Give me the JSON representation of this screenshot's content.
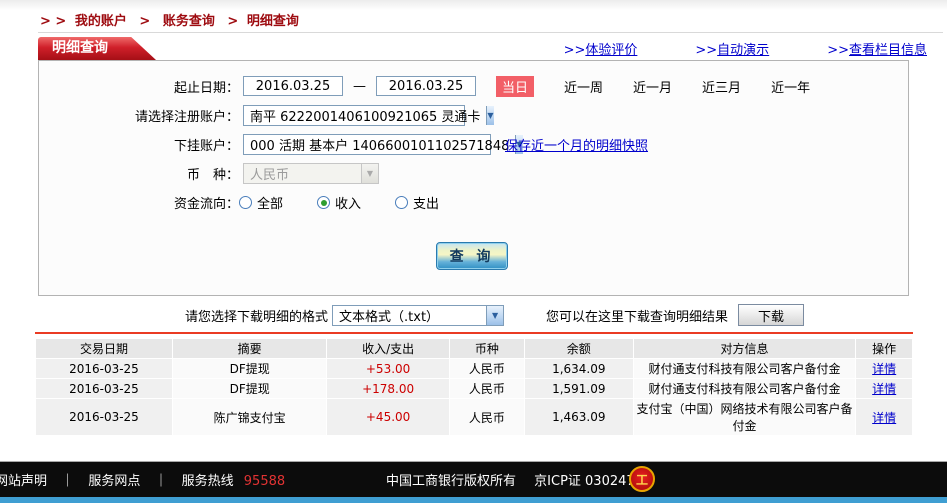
{
  "breadcrumb": {
    "prefix": "> >",
    "sep": ">",
    "items": [
      "我的账户",
      "账务查询",
      "明细查询"
    ]
  },
  "tab": {
    "title": "明细查询"
  },
  "links_prefix": ">>",
  "links": [
    "体验评价",
    "自动演示",
    "查看栏目信息"
  ],
  "form": {
    "date_label": "起止日期：",
    "date_from": "2016.03.25",
    "date_sep": "—",
    "date_to": "2016.03.25",
    "quick": {
      "active": "当日",
      "options": [
        "近一周",
        "近一月",
        "近三月",
        "近一年"
      ]
    },
    "account_label": "请选择注册账户：",
    "account_value": "南平 6222001406100921065 灵通卡",
    "sub_account_label": "下挂账户：",
    "sub_account_value": "000 活期 基本户 1406600101102571848",
    "snapshot_link": "保存近一个月的明细快照",
    "currency_label": "币　种：",
    "currency_value": "人民币",
    "flow_label": "资金流向：",
    "flow": {
      "options": [
        "全部",
        "收入",
        "支出"
      ],
      "selected": "收入"
    },
    "query_button": "查 询"
  },
  "download": {
    "format_label": "请您选择下载明细的格式",
    "format_value": "文本格式（.txt）",
    "hint": "您可以在这里下载查询明细结果",
    "button": "下载"
  },
  "table": {
    "headers": [
      "交易日期",
      "摘要",
      "收入/支出",
      "币种",
      "余额",
      "对方信息",
      "操作"
    ],
    "rows": [
      {
        "date": "2016-03-25",
        "summary": "DF提现",
        "amount": "+53.00",
        "currency": "人民币",
        "balance": "1,634.09",
        "counterparty": "财付通支付科技有限公司客户备付金",
        "action": "详情"
      },
      {
        "date": "2016-03-25",
        "summary": "DF提现",
        "amount": "+178.00",
        "currency": "人民币",
        "balance": "1,591.09",
        "counterparty": "财付通支付科技有限公司客户备付金",
        "action": "详情"
      },
      {
        "date": "2016-03-25",
        "summary": "陈广锦支付宝",
        "amount": "+45.00",
        "currency": "人民币",
        "balance": "1,463.09",
        "counterparty": "支付宝（中国）网络技术有限公司客户备付金",
        "action": "详情"
      }
    ]
  },
  "footer": {
    "link_statement": "网站声明",
    "link_branches": "服务网点",
    "sep": "｜",
    "hotline_label": "服务热线",
    "hotline_number": "95588",
    "copyright": "中国工商银行版权所有",
    "icp": "京ICP证 030247号",
    "badge_glyph": "工"
  },
  "colors": {
    "brand_red": "#a50f16",
    "breadcrumb_red": "#9e0b10",
    "link_blue": "#0000cc",
    "active_chip_red": "#f25f67",
    "amount_red": "#cc0000",
    "separator_red": "#ea3b23",
    "footer_black": "#0c0c0c",
    "bottom_bar_blue": "#3f9ed2"
  }
}
